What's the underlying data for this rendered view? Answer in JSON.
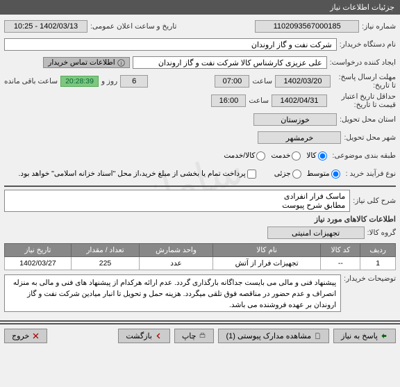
{
  "titlebar": "جزئیات اطلاعات نیاز",
  "fields": {
    "request_no_label": "شماره نیاز:",
    "request_no": "1102093567000185",
    "announce_dt_label": "تاریخ و ساعت اعلان عمومی:",
    "announce_dt": "1402/03/13 - 10:25",
    "buyer_org_label": "نام دستگاه خریدار:",
    "buyer_org": "شرکت نفت و گاز اروندان",
    "requester_label": "ایجاد کننده درخواست:",
    "requester": "علی عزیزی کارشناس کالا شرکت نفت و گاز اروندان",
    "contact_info_btn": "اطلاعات تماس خریدار",
    "resp_deadline_label": "مهلت ارسال پاسخ: تا تاریخ:",
    "resp_date": "1402/03/20",
    "time_label": "ساعت",
    "resp_time": "07:00",
    "days_remaining": "6",
    "days_label": "روز و",
    "countdown": "20:28:39",
    "countdown_label": "ساعت باقی مانده",
    "price_valid_label": "حداقل تاریخ اعتبار قیمت تا تاریخ:",
    "price_valid_date": "1402/04/31",
    "price_valid_time": "16:00",
    "province_label": "استان محل تحویل:",
    "province": "خوزستان",
    "city_label": "شهر محل تحویل:",
    "city": "خرمشهر",
    "category_label": "طبقه بندی موضوعی:",
    "cat_goods": "کالا",
    "cat_service": "خدمت",
    "cat_goods_service": "کالا/خدمت",
    "process_label": "نوع فرآیند خرید :",
    "proc_medium": "متوسط",
    "proc_partial": "جزئی",
    "payment_note": "پرداخت تمام یا بخشی از مبلغ خرید،از محل \"اسناد خزانه اسلامی\" خواهد بود.",
    "need_title_label": "شرح کلی نیاز:",
    "need_title": "ماسک فرار انفرادی\nمطابق شرح پیوست",
    "items_section": "اطلاعات کالاهای مورد نیاز",
    "goods_group_label": "گروه کالا:",
    "goods_group": "تجهیزات امنیتی",
    "buyer_desc_label": "توضیحات خریدار:",
    "buyer_desc": "پیشنهاد فنی و مالی می بایست جداگانه بارگذاری گردد. عدم ارائه هرکدام از  پیشنهاد های فنی و مالی به منزله انصراف و عدم حضور در مناقصه فوق تلقی میگردد.\nهزینه حمل و تحویل تا انبار میادین شرکت نفت و گاز اروندان بر عهده فروشنده می باشد."
  },
  "table": {
    "headers": {
      "row": "ردیف",
      "code": "کد کالا",
      "name": "نام کالا",
      "unit": "واحد شمارش",
      "qty": "تعداد / مقدار",
      "date": "تاریخ نیاز"
    },
    "rows": [
      {
        "row": "1",
        "code": "--",
        "name": "تجهیزات فرار از آتش",
        "unit": "عدد",
        "qty": "225",
        "date": "1402/03/27"
      }
    ]
  },
  "buttons": {
    "reply": "پاسخ به نیاز",
    "attachments": "مشاهده مدارک پیوستی (1)",
    "print": "چاپ",
    "back": "بازگشت",
    "exit": "خروج"
  }
}
